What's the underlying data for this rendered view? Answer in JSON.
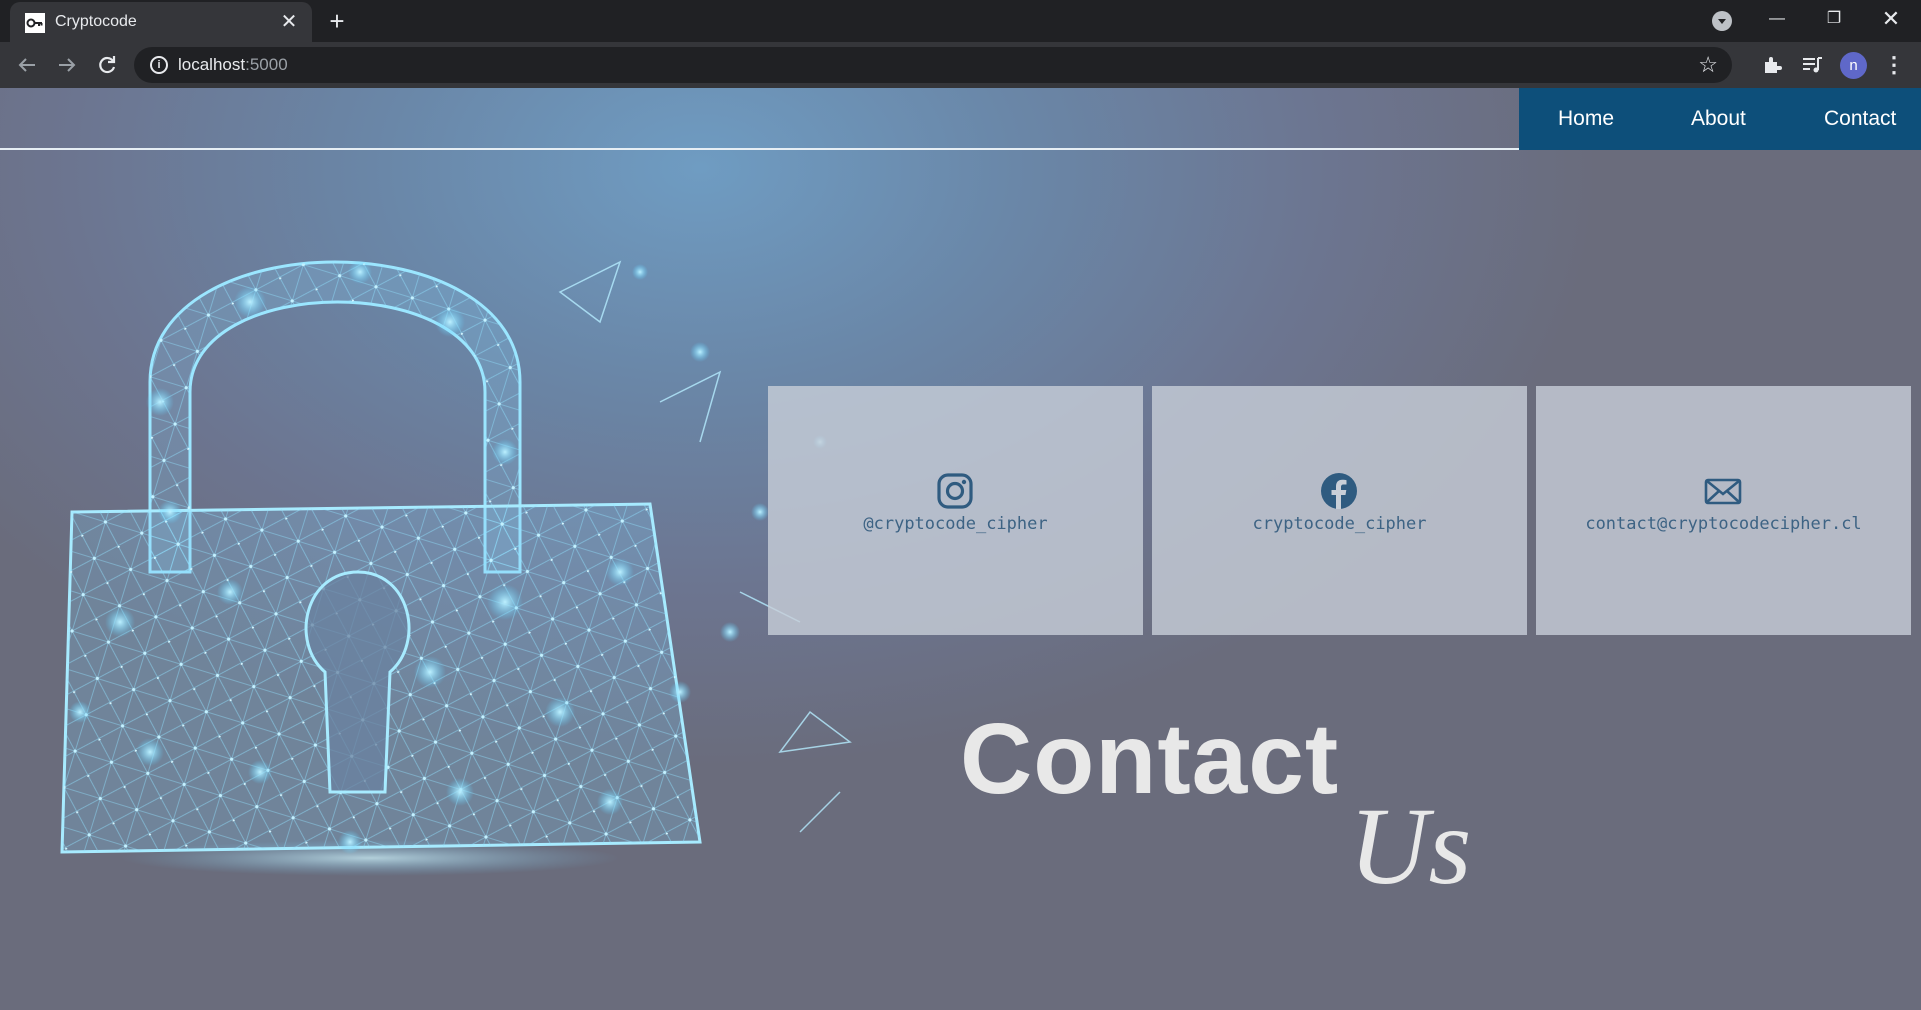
{
  "browser": {
    "tab_title": "Cryptocode",
    "tab_close": "✕",
    "new_tab": "+",
    "url_host": "localhost",
    "url_port": ":5000",
    "avatar_letter": "n",
    "window_controls": {
      "minimize": "—",
      "maximize": "❐",
      "close": "✕"
    },
    "icons": [
      "key-icon",
      "back-icon",
      "forward-icon",
      "reload-icon",
      "info-icon",
      "star-icon",
      "extensions-icon",
      "media-icon",
      "menu-icon",
      "tab-search-icon"
    ]
  },
  "nav": {
    "items": [
      {
        "label": "Home"
      },
      {
        "label": "About"
      },
      {
        "label": "Contact"
      }
    ],
    "background": "#0d4f7a"
  },
  "contacts": [
    {
      "icon": "instagram-icon",
      "text": "@cryptocode_cipher"
    },
    {
      "icon": "facebook-icon",
      "text": "cryptocode_cipher"
    },
    {
      "icon": "mail-icon",
      "text": "contact@cryptocodecipher.cl"
    }
  ],
  "heading": {
    "line1": "Contact",
    "line2": "Us"
  },
  "colors": {
    "accent": "#0d4f7a",
    "card_text": "#3d6384",
    "lock_glow": "#7fd3f5"
  }
}
